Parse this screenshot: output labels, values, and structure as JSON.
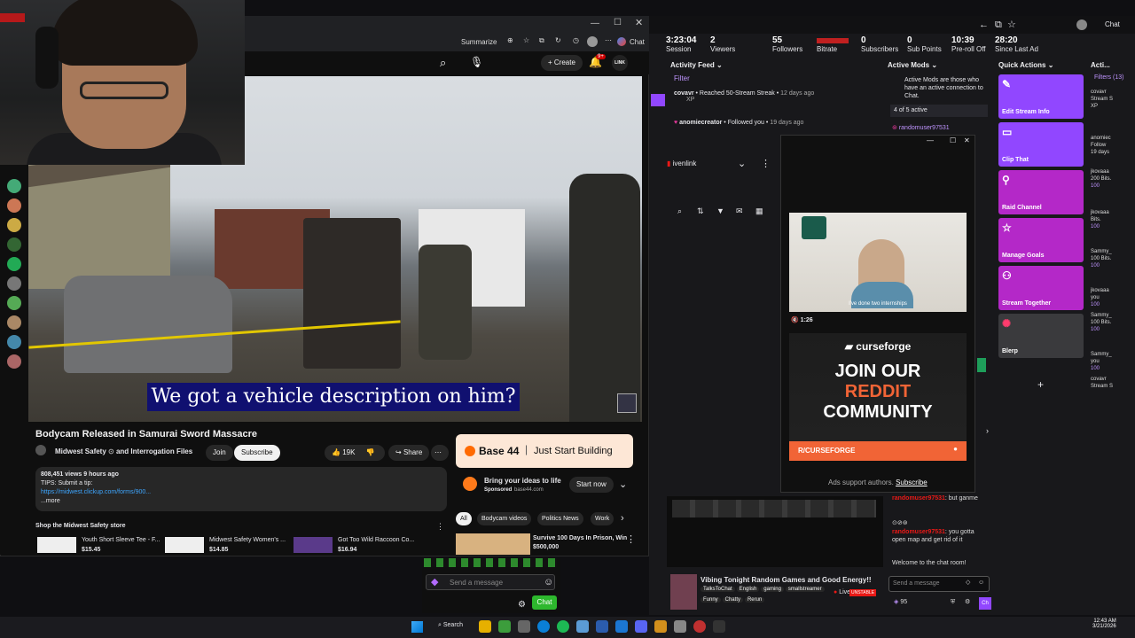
{
  "webcam": {},
  "browser": {
    "toolbar": {
      "summarize": "Summarize",
      "chat": "Chat"
    },
    "yt": {
      "create_label": "Create",
      "notif_count": "9+",
      "avatar_text": "LINK"
    },
    "video": {
      "caption": "We got a vehicle description on him?"
    },
    "title": "Bodycam Released in Samurai Sword Massacre",
    "channel": "Midwest Safety",
    "channel_suffix": "and Interrogation Files",
    "join": "Join",
    "subscribe": "Subscribe",
    "likes": "19K",
    "share": "Share",
    "desc": {
      "views": "808,451 views  9 hours ago",
      "tips": "TIPS: Submit a tip:",
      "link": "https://midwest.clickup.com/forms/900...",
      "more": "...more"
    },
    "shop": {
      "heading": "Shop the Midwest Safety store",
      "items": [
        {
          "name": "Youth Short Sleeve Tee - F...",
          "price": "$15.45"
        },
        {
          "name": "Midwest Safety Women's ...",
          "price": "$14.85"
        },
        {
          "name": "Got Too Wild Raccoon Co...",
          "price": "$16.94"
        }
      ]
    },
    "ad": {
      "brand": "Base 44",
      "tagline": "Just Start Building",
      "headline": "Bring your ideas to life",
      "sponsored": "Sponsored",
      "domain": "base44.com",
      "cta": "Start now"
    },
    "chips": [
      "All",
      "Bodycam videos",
      "Politics News",
      "Work"
    ],
    "rec": {
      "title": "Survive 100 Days In Prison, Win",
      "subtitle": "$500,000"
    }
  },
  "stats": [
    {
      "value": "3:23:04",
      "label": "Session"
    },
    {
      "value": "2",
      "label": "Viewers"
    },
    {
      "value": "55",
      "label": "Followers"
    },
    {
      "value": "",
      "label": "Bitrate"
    },
    {
      "value": "0",
      "label": "Subscribers"
    },
    {
      "value": "0",
      "label": "Sub Points"
    },
    {
      "value": "10:39",
      "label": "Pre-roll Off"
    },
    {
      "value": "28:20",
      "label": "Since Last Ad"
    }
  ],
  "activity": {
    "title": "Activity Feed",
    "filter": "Filter",
    "items": [
      {
        "user": "covavr",
        "text": "Reached 50-Stream Streak",
        "time": "12 days ago",
        "extra": "XP"
      },
      {
        "user": "anomiecreator",
        "text": "Followed you",
        "time": "19 days ago",
        "extra": ""
      }
    ]
  },
  "mods": {
    "title": "Active Mods",
    "desc": "Active Mods are those who have an active connection to Chat.",
    "count": "4 of 5 active",
    "user": "randomuser97531"
  },
  "quick_actions": {
    "title": "Quick Actions",
    "items": [
      {
        "label": "Edit Stream Info",
        "icon": "pencil-icon"
      },
      {
        "label": "Clip That",
        "icon": "clip-icon"
      },
      {
        "label": "Raid Channel",
        "icon": "raid-icon"
      },
      {
        "label": "Manage Goals",
        "icon": "star-icon"
      },
      {
        "label": "Stream Together",
        "icon": "person-plus-icon"
      },
      {
        "label": "Blerp",
        "icon": "blerp-icon"
      }
    ]
  },
  "act_col": {
    "title": "Acti...",
    "filters": "Filters (13)",
    "items": [
      {
        "user": "covavr",
        "text": "Stream S",
        "sub": "XP"
      },
      {
        "user": "anomiec",
        "text": "Follow",
        "sub": "19 days"
      },
      {
        "user": "jkovaaa",
        "text": "200 Bits.",
        "sub": "100"
      },
      {
        "user": "jkovaaa",
        "text": "Bits.",
        "sub": "100"
      },
      {
        "user": "Sammy_",
        "text": "100 Bits.",
        "sub": "100"
      },
      {
        "user": "jkovaaa",
        "text": "you",
        "sub": "100"
      },
      {
        "user": "Sammy_",
        "text": "100 Bits.",
        "sub": "100"
      },
      {
        "user": "Sammy_",
        "text": "you",
        "sub": "100"
      },
      {
        "user": "covavr",
        "text": "Stream S",
        "sub": ""
      }
    ]
  },
  "dock": {
    "channel": "ivenlink"
  },
  "adpop": {
    "video_caption": "I've done two internships",
    "time": "1:26",
    "cf_brand": "curseforge",
    "line1": "JOIN OUR",
    "line2": "REDDIT",
    "line3": "COMMUNITY",
    "handle": "R/CURSEFORGE",
    "support": "Ads support authors.",
    "subscribe": "Subscribe"
  },
  "chat": {
    "messages": [
      {
        "user": "randomuser97531",
        "text": "but ganme"
      },
      {
        "user": "randomuser97531",
        "text": "you gotta open map and get rid of it"
      }
    ],
    "welcome": "Welcome to the chat room!",
    "placeholder": "Send a message",
    "points": "95",
    "chat_btn": "Chat"
  },
  "browser_chat": {
    "placeholder": "Send a message",
    "btn": "Chat"
  },
  "stream": {
    "title": "Vibing Tonight Random Games and Good Energy!!",
    "tags": [
      "TalksToChat",
      "English",
      "gaming",
      "smallstreamer"
    ],
    "tags2": [
      "Funny",
      "Chatty",
      "Rerun"
    ],
    "live": "Live",
    "unstable": "UNSTABLE"
  },
  "taskbar": {
    "search": "Search",
    "time": "12:43 AM",
    "date": "3/21/2026"
  }
}
